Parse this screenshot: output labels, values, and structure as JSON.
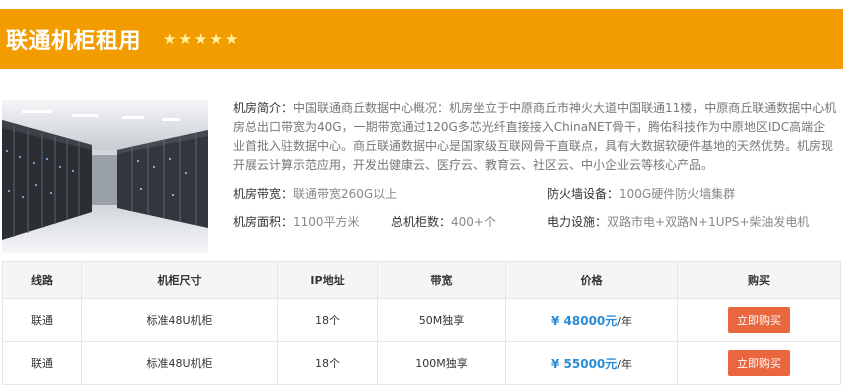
{
  "header": {
    "title": "联通机柜租用",
    "star_count": 5,
    "star_color": "#fff3a0",
    "background_color": "#f39c00"
  },
  "image": {
    "description_icon": "server-room-image"
  },
  "info": {
    "intro_label": "机房简介：",
    "intro_text": "中国联通商丘数据中心概况：机房坐立于中原商丘市神火大道中国联通11楼，中原商丘联通数据中心机房总出口带宽为40G，一期带宽通过120G多芯光纤直接接入ChinaNET骨干，腾佑科技作为中原地区IDC高端企业首批入驻数据中心。商丘联通数据中心是国家级互联网骨干直联点，具有大数据软硬件基地的天然优势。机房现开展云计算示范应用，开发出健康云、医疗云、教育云、社区云、中小企业云等核心产品。",
    "bandwidth_label": "机房带宽：",
    "bandwidth_value": "联通带宽260G以上",
    "firewall_label": "防火墙设备：",
    "firewall_value": "100G硬件防火墙集群",
    "area_label": "机房面积：",
    "area_value": "1100平方米",
    "cabinets_label": "总机柜数：",
    "cabinets_value": "400+个",
    "power_label": "电力设施：",
    "power_value": "双路市电+双路N+1UPS+柴油发电机"
  },
  "table": {
    "headers": [
      "线路",
      "机柜尺寸",
      "IP地址",
      "带宽",
      "价格",
      "购买"
    ],
    "rows": [
      {
        "line": "联通",
        "size": "标准48U机柜",
        "ip": "18个",
        "bandwidth": "50M独享",
        "price": "¥ 48000元",
        "unit": "/年",
        "buy": "立即购买"
      },
      {
        "line": "联通",
        "size": "标准48U机柜",
        "ip": "18个",
        "bandwidth": "100M独享",
        "price": "¥ 55000元",
        "unit": "/年",
        "buy": "立即购买"
      }
    ]
  }
}
